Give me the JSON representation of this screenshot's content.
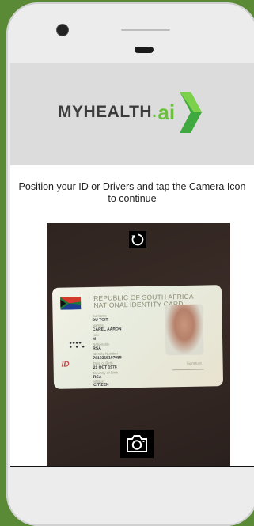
{
  "header": {
    "logo_text": "MYHEALTH",
    "logo_dot": ".",
    "logo_ai": "ai"
  },
  "instructions": "Position your ID or Drivers and tap the Camera Icon to continue",
  "id_card": {
    "title_line1": "REPUBLIC OF SOUTH AFRICA",
    "title_line2": "NATIONAL IDENTITY CARD",
    "fields": [
      {
        "label": "Surname",
        "value": "DU TOIT"
      },
      {
        "label": "Names",
        "value": "CAREL AARON"
      },
      {
        "label": "Sex",
        "value": "M"
      },
      {
        "label": "Nationality",
        "value": "RSA"
      },
      {
        "label": "Identity Number",
        "value": "7810215107089"
      },
      {
        "label": "Date of Birth",
        "value": "21 OCT 1978"
      },
      {
        "label": "Country of Birth",
        "value": "RSA"
      },
      {
        "label": "Status",
        "value": "CITIZEN"
      }
    ],
    "signature_label": "Signature",
    "card_logo": "ID"
  },
  "icons": {
    "rotate": "rotate-icon",
    "camera": "camera-icon"
  },
  "colors": {
    "background": "#5a8a36",
    "brand_green": "#6cbf3a",
    "brand_dark": "#3b3b3b"
  }
}
